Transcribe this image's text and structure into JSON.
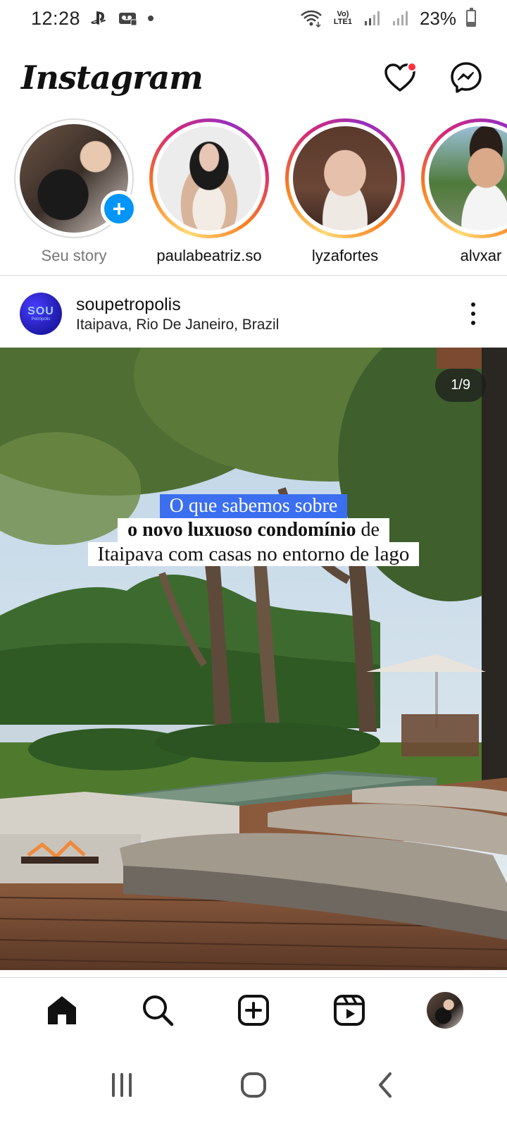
{
  "status_bar": {
    "time": "12:28",
    "network_label": "Vo) LTE1",
    "battery": "23%"
  },
  "header": {
    "logo_text": "Instagram"
  },
  "stories": [
    {
      "username": "Seu story",
      "is_own": true
    },
    {
      "username": "paulabeatriz.so",
      "is_own": false
    },
    {
      "username": "lyzafortes",
      "is_own": false
    },
    {
      "username": "alvxar",
      "is_own": false
    }
  ],
  "post": {
    "username": "soupetropolis",
    "location": "Itaipava, Rio De Janeiro, Brazil",
    "avatar_text_big": "SOU",
    "avatar_text_small": "Petrópolis",
    "counter": "1/9",
    "caption_line1": "O que sabemos sobre",
    "caption_line2_bold": "o novo luxuoso condomínio",
    "caption_line2_normal": "de",
    "caption_line3": "Itaipava com casas no entorno de lago"
  },
  "colors": {
    "accent_blue": "#0095f6",
    "notification_red": "#ff3040",
    "caption_highlight": "#3b6ff0"
  }
}
